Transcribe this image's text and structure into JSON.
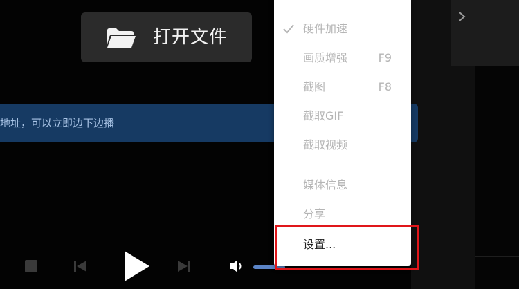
{
  "open_file": {
    "label": "打开文件",
    "icon": "folder-icon"
  },
  "url_bar": {
    "text": "地址，可以立即边下边播"
  },
  "context_menu": {
    "items": [
      {
        "label": "硬件加速",
        "shortcut": "",
        "checked": true
      },
      {
        "label": "画质增强",
        "shortcut": "F9",
        "checked": false
      },
      {
        "label": "截图",
        "shortcut": "F8",
        "checked": false
      },
      {
        "label": "截取GIF",
        "shortcut": "",
        "checked": false
      },
      {
        "label": "截取视频",
        "shortcut": "",
        "checked": false
      },
      {
        "label": "媒体信息",
        "shortcut": "",
        "checked": false
      },
      {
        "label": "分享",
        "shortcut": "",
        "checked": false
      },
      {
        "label": "设置...",
        "shortcut": "",
        "checked": false
      }
    ]
  },
  "controls": {
    "icons": [
      "stop-icon",
      "previous-icon",
      "play-icon",
      "next-icon",
      "volume-icon"
    ]
  },
  "colors": {
    "background": "#030303",
    "url_bar": "#163a63",
    "highlight_border": "#e0161a",
    "volume_fill": "#5b84c6"
  }
}
